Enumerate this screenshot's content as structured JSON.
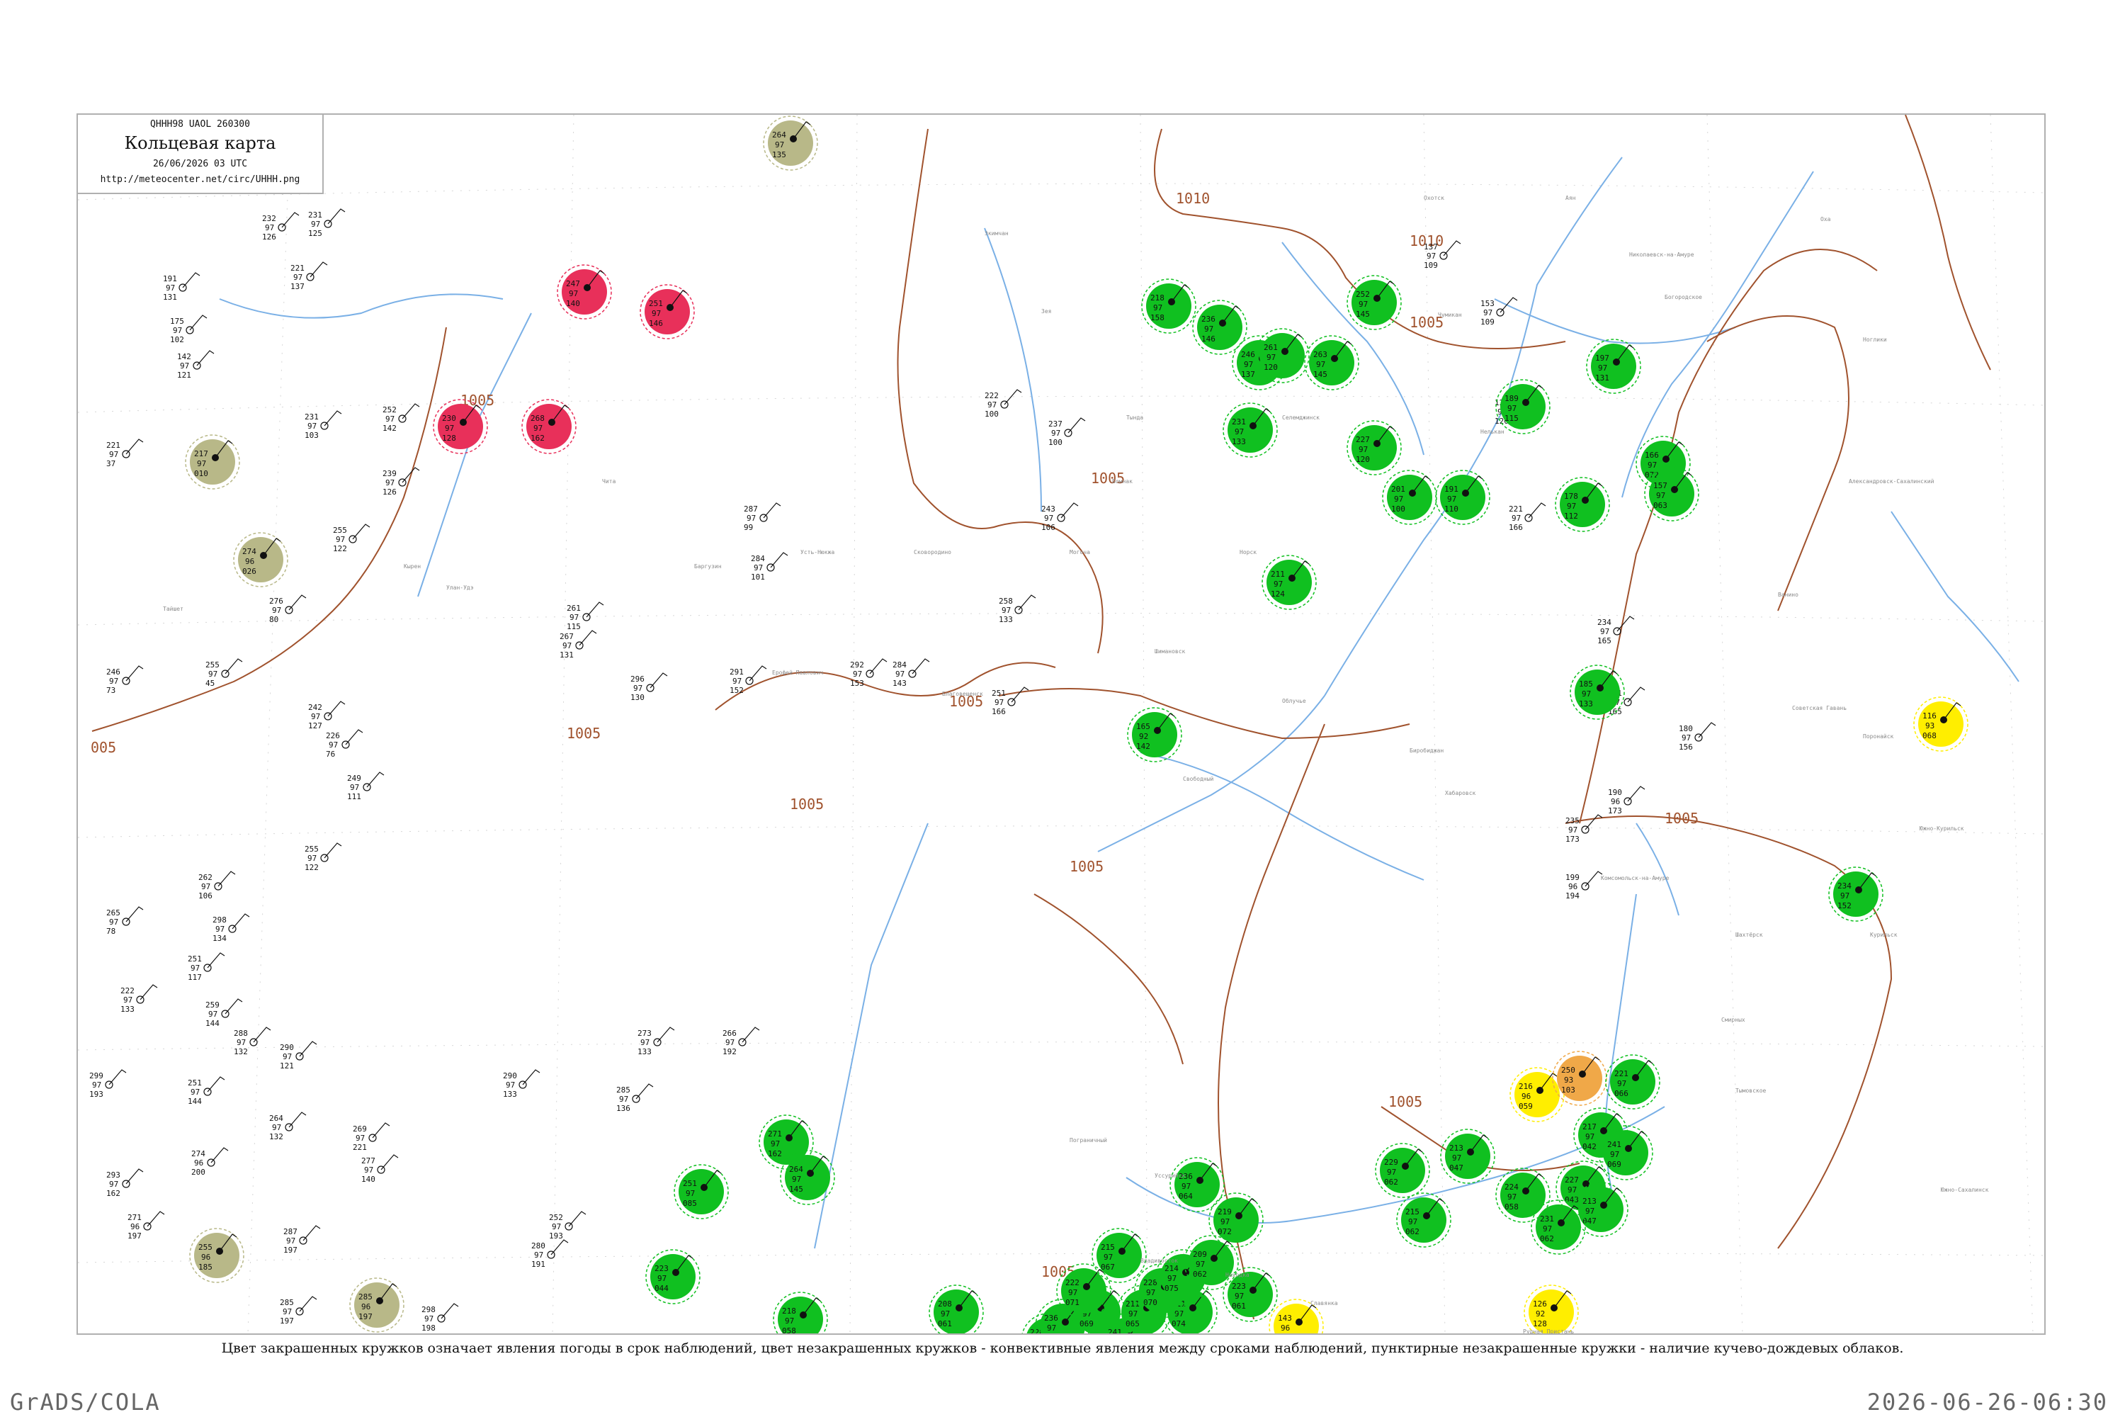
{
  "header": {
    "code_line": "QHHH98  UAOL  260300",
    "title": "Кольцевая карта",
    "date_line": "26/06/2026 03 UTC",
    "url": "http://meteocenter.net/circ/UHHH.png"
  },
  "caption": "Цвет закрашенных кружков означает явления погоды в срок наблюдений, цвет незакрашенных кружков - конвективные явления между сроками наблюдений, пунктирные незакрашенные кружки - наличие кучево-дождевых облаков.",
  "footer": {
    "left": "GrADS/COLA",
    "right": "2026-06-26-06:30"
  },
  "colors": {
    "rain": "#10c020",
    "thunder": "#e8305a",
    "fog": "#ffee00",
    "haze": "#b8b888",
    "snow": "#f0a848",
    "isobar": "#a0522d",
    "river": "#7ab0e6",
    "dashed_ring": "#3bb54a"
  },
  "isobars": [
    {
      "label": "1010"
    },
    {
      "label": "1010"
    },
    {
      "label": "1005"
    },
    {
      "label": "1005"
    },
    {
      "label": "1005"
    },
    {
      "label": "1005"
    },
    {
      "label": "1005"
    },
    {
      "label": "1005"
    },
    {
      "label": "1005"
    },
    {
      "label": "1005"
    },
    {
      "label": "005"
    },
    {
      "label": "1005"
    },
    {
      "label": "1005"
    }
  ],
  "stations": [
    {
      "kind": "rain",
      "t": "246",
      "p": "97",
      "d": "137"
    },
    {
      "kind": "rain",
      "t": "252",
      "p": "97",
      "d": "145"
    },
    {
      "kind": "thunder",
      "t": "247",
      "p": "97",
      "d": "140"
    },
    {
      "kind": "thunder",
      "t": "251",
      "p": "97",
      "d": "146"
    },
    {
      "kind": "thunder",
      "t": "230",
      "p": "97",
      "d": "128"
    },
    {
      "kind": "thunder",
      "t": "268",
      "p": "97",
      "d": "162"
    },
    {
      "kind": "haze",
      "t": "264",
      "p": "97",
      "d": "135"
    },
    {
      "kind": "haze",
      "t": "217",
      "p": "97",
      "d": "010"
    },
    {
      "kind": "haze",
      "t": "274",
      "p": "96",
      "d": "026"
    },
    {
      "kind": "haze",
      "t": "255",
      "p": "96",
      "d": "185"
    },
    {
      "kind": "haze",
      "t": "285",
      "p": "96",
      "d": "197"
    },
    {
      "kind": "rain",
      "t": "261",
      "p": "97",
      "d": "120"
    },
    {
      "kind": "rain",
      "t": "263",
      "p": "97",
      "d": "145"
    },
    {
      "kind": "rain",
      "t": "218",
      "p": "97",
      "d": "158"
    },
    {
      "kind": "rain",
      "t": "236",
      "p": "97",
      "d": "146"
    },
    {
      "kind": "rain",
      "t": "231",
      "p": "97",
      "d": "133"
    },
    {
      "kind": "rain",
      "t": "227",
      "p": "97",
      "d": "120"
    },
    {
      "kind": "rain",
      "t": "201",
      "p": "97",
      "d": "100"
    },
    {
      "kind": "rain",
      "t": "191",
      "p": "97",
      "d": "110"
    },
    {
      "kind": "rain",
      "t": "189",
      "p": "97",
      "d": "115"
    },
    {
      "kind": "rain",
      "t": "178",
      "p": "97",
      "d": "112"
    },
    {
      "kind": "rain",
      "t": "197",
      "p": "97",
      "d": "131"
    },
    {
      "kind": "rain",
      "t": "166",
      "p": "97",
      "d": "072"
    },
    {
      "kind": "rain",
      "t": "157",
      "p": "97",
      "d": "063"
    },
    {
      "kind": "rain",
      "t": "185",
      "p": "97",
      "d": "133"
    },
    {
      "kind": "rain",
      "t": "234",
      "p": "97",
      "d": "152"
    },
    {
      "kind": "rain",
      "t": "211",
      "p": "97",
      "d": "124"
    },
    {
      "kind": "rain",
      "t": "165",
      "p": "92",
      "d": "142"
    },
    {
      "kind": "fog",
      "t": "116",
      "p": "93",
      "d": "068"
    },
    {
      "kind": "fog",
      "t": "143",
      "p": "96",
      "d": "046"
    },
    {
      "kind": "fog",
      "t": "126",
      "p": "92",
      "d": "128"
    },
    {
      "kind": "fog",
      "t": "216",
      "p": "96",
      "d": "059"
    },
    {
      "kind": "snow",
      "t": "250",
      "p": "93",
      "d": "103"
    },
    {
      "kind": "rain",
      "t": "217",
      "p": "97",
      "d": "042"
    },
    {
      "kind": "rain",
      "t": "227",
      "p": "97",
      "d": "043"
    },
    {
      "kind": "rain",
      "t": "213",
      "p": "97",
      "d": "047"
    },
    {
      "kind": "rain",
      "t": "231",
      "p": "97",
      "d": "062"
    },
    {
      "kind": "rain",
      "t": "241",
      "p": "97",
      "d": "069"
    },
    {
      "kind": "rain",
      "t": "221",
      "p": "97",
      "d": "066"
    },
    {
      "kind": "rain",
      "t": "224",
      "p": "97",
      "d": "058"
    },
    {
      "kind": "rain",
      "t": "236",
      "p": "97",
      "d": "064"
    },
    {
      "kind": "rain",
      "t": "213",
      "p": "97",
      "d": "047"
    },
    {
      "kind": "rain",
      "t": "229",
      "p": "97",
      "d": "062"
    },
    {
      "kind": "rain",
      "t": "215",
      "p": "97",
      "d": "062"
    },
    {
      "kind": "rain",
      "t": "219",
      "p": "97",
      "d": "072"
    },
    {
      "kind": "rain",
      "t": "223",
      "p": "97",
      "d": "061"
    },
    {
      "kind": "rain",
      "t": "211",
      "p": "97",
      "d": "074"
    },
    {
      "kind": "rain",
      "t": "228",
      "p": "97",
      "d": "063"
    },
    {
      "kind": "rain",
      "t": "236",
      "p": "97",
      "d": "059"
    },
    {
      "kind": "rain",
      "t": "210",
      "p": "97",
      "d": "069"
    },
    {
      "kind": "rain",
      "t": "241",
      "p": "97",
      "d": "070"
    },
    {
      "kind": "rain",
      "t": "211",
      "p": "97",
      "d": "065"
    },
    {
      "kind": "rain",
      "t": "228",
      "p": "97",
      "d": "070"
    },
    {
      "kind": "rain",
      "t": "214",
      "p": "97",
      "d": "075"
    },
    {
      "kind": "rain",
      "t": "209",
      "p": "97",
      "d": "062"
    },
    {
      "kind": "rain",
      "t": "222",
      "p": "97",
      "d": "071"
    },
    {
      "kind": "rain",
      "t": "215",
      "p": "97",
      "d": "067"
    },
    {
      "kind": "rain",
      "t": "271",
      "p": "97",
      "d": "162"
    },
    {
      "kind": "rain",
      "t": "264",
      "p": "97",
      "d": "145"
    },
    {
      "kind": "rain",
      "t": "251",
      "p": "97",
      "d": "085"
    },
    {
      "kind": "rain",
      "t": "223",
      "p": "97",
      "d": "044"
    },
    {
      "kind": "rain",
      "t": "218",
      "p": "97",
      "d": "058"
    },
    {
      "kind": "rain",
      "t": "208",
      "p": "97",
      "d": "061"
    }
  ],
  "plain_stations": [
    {
      "t": "232",
      "p": "97",
      "d": "126"
    },
    {
      "t": "231",
      "p": "97",
      "d": "125"
    },
    {
      "t": "221",
      "p": "97",
      "d": "137"
    },
    {
      "t": "191",
      "p": "97",
      "d": "131"
    },
    {
      "t": "175",
      "p": "97",
      "d": "102"
    },
    {
      "t": "142",
      "p": "97",
      "d": "121"
    },
    {
      "t": "221",
      "p": "97",
      "d": "37"
    },
    {
      "t": "231",
      "p": "97",
      "d": "103"
    },
    {
      "t": "252",
      "p": "97",
      "d": "142"
    },
    {
      "t": "239",
      "p": "97",
      "d": "126"
    },
    {
      "t": "255",
      "p": "97",
      "d": "122"
    },
    {
      "t": "276",
      "p": "97",
      "d": "80"
    },
    {
      "t": "255",
      "p": "97",
      "d": "45"
    },
    {
      "t": "246",
      "p": "97",
      "d": "73"
    },
    {
      "t": "242",
      "p": "97",
      "d": "127"
    },
    {
      "t": "226",
      "p": "97",
      "d": "76"
    },
    {
      "t": "249",
      "p": "97",
      "d": "111"
    },
    {
      "t": "255",
      "p": "97",
      "d": "122"
    },
    {
      "t": "262",
      "p": "97",
      "d": "106"
    },
    {
      "t": "265",
      "p": "97",
      "d": "78"
    },
    {
      "t": "298",
      "p": "97",
      "d": "134"
    },
    {
      "t": "251",
      "p": "97",
      "d": "117"
    },
    {
      "t": "222",
      "p": "97",
      "d": "133"
    },
    {
      "t": "259",
      "p": "97",
      "d": "144"
    },
    {
      "t": "288",
      "p": "97",
      "d": "132"
    },
    {
      "t": "290",
      "p": "97",
      "d": "121"
    },
    {
      "t": "299",
      "p": "97",
      "d": "193"
    },
    {
      "t": "251",
      "p": "97",
      "d": "144"
    },
    {
      "t": "264",
      "p": "97",
      "d": "132"
    },
    {
      "t": "277",
      "p": "97",
      "d": "140"
    },
    {
      "t": "269",
      "p": "97",
      "d": "221"
    },
    {
      "t": "274",
      "p": "96",
      "d": "200"
    },
    {
      "t": "293",
      "p": "97",
      "d": "162"
    },
    {
      "t": "271",
      "p": "96",
      "d": "197"
    },
    {
      "t": "287",
      "p": "97",
      "d": "197"
    },
    {
      "t": "285",
      "p": "97",
      "d": "197"
    },
    {
      "t": "298",
      "p": "97",
      "d": "198"
    },
    {
      "t": "252",
      "p": "97",
      "d": "193"
    },
    {
      "t": "280",
      "p": "97",
      "d": "191"
    },
    {
      "t": "290",
      "p": "97",
      "d": "133"
    },
    {
      "t": "266",
      "p": "97",
      "d": "192"
    },
    {
      "t": "285",
      "p": "97",
      "d": "136"
    },
    {
      "t": "273",
      "p": "97",
      "d": "133"
    },
    {
      "t": "261",
      "p": "97",
      "d": "115"
    },
    {
      "t": "267",
      "p": "97",
      "d": "131"
    },
    {
      "t": "291",
      "p": "97",
      "d": "152"
    },
    {
      "t": "287",
      "p": "97",
      "d": "99"
    },
    {
      "t": "284",
      "p": "97",
      "d": "101"
    },
    {
      "t": "296",
      "p": "97",
      "d": "130"
    },
    {
      "t": "292",
      "p": "97",
      "d": "153"
    },
    {
      "t": "284",
      "p": "97",
      "d": "143"
    },
    {
      "t": "243",
      "p": "97",
      "d": "106"
    },
    {
      "t": "237",
      "p": "97",
      "d": "100"
    },
    {
      "t": "222",
      "p": "97",
      "d": "100"
    },
    {
      "t": "258",
      "p": "97",
      "d": "133"
    },
    {
      "t": "251",
      "p": "97",
      "d": "166"
    },
    {
      "t": "137",
      "p": "97",
      "d": "109"
    },
    {
      "t": "153",
      "p": "97",
      "d": "109"
    },
    {
      "t": "120",
      "p": "97",
      "d": "120"
    },
    {
      "t": "221",
      "p": "97",
      "d": "166"
    },
    {
      "t": "234",
      "p": "97",
      "d": "165"
    },
    {
      "t": "171",
      "p": "97",
      "d": "165"
    },
    {
      "t": "180",
      "p": "97",
      "d": "156"
    },
    {
      "t": "190",
      "p": "96",
      "d": "173"
    },
    {
      "t": "235",
      "p": "97",
      "d": "173"
    },
    {
      "t": "199",
      "p": "96",
      "d": "194"
    }
  ],
  "place_names": [
    "Николаевск-на-Амуре",
    "Богородское",
    "Аян",
    "Охотск",
    "Чумикан",
    "Экимчан",
    "Зея",
    "Тында",
    "Могоча",
    "Чита",
    "Благовещенск",
    "Хабаровск",
    "Комсомольск-на-Амуре",
    "Советская Гавань",
    "Ванино",
    "Южно-Сахалинск",
    "Оха",
    "Ноглики",
    "Александровск-Сахалинский",
    "Поронайск",
    "Владивосток",
    "Находка",
    "Уссурийск",
    "Биробиджан",
    "Облучье",
    "Бомнак",
    "Норск",
    "Селемджинск",
    "Нелькан",
    "Кырен",
    "Улан-Удэ",
    "Баргузин",
    "Сковородино",
    "Усть-Нюкжа",
    "Ерофей Павлович",
    "Тайшет",
    "Свободный",
    "Шимановск",
    "Пограничный",
    "Рудная Пристань",
    "Славянка",
    "Курильск",
    "Южно-Курильск",
    "Шахтёрск",
    "Смирных",
    "Тымовское"
  ]
}
